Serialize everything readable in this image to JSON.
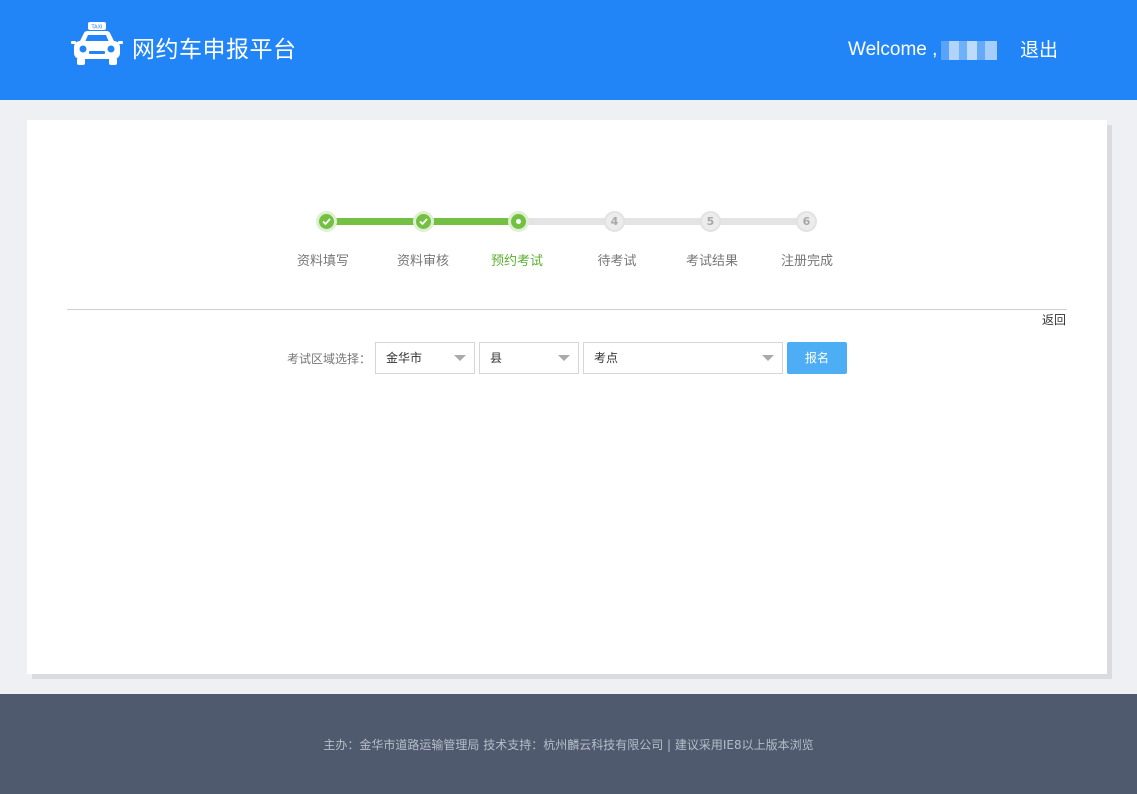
{
  "header": {
    "brand": "网约车申报平台",
    "welcome": "Welcome ,",
    "logout": "退出",
    "logo_icon": "taxi-icon"
  },
  "steps": [
    {
      "label": "资料填写",
      "number": "1",
      "state": "done"
    },
    {
      "label": "资料审核",
      "number": "2",
      "state": "done"
    },
    {
      "label": "预约考试",
      "number": "3",
      "state": "current"
    },
    {
      "label": "待考试",
      "number": "4",
      "state": "todo"
    },
    {
      "label": "考试结果",
      "number": "5",
      "state": "todo"
    },
    {
      "label": "注册完成",
      "number": "6",
      "state": "todo"
    }
  ],
  "back": "返回",
  "form": {
    "label": "考试区域选择：",
    "city": "金华市",
    "county": "县",
    "site": "考点",
    "submit": "报名"
  },
  "footer": {
    "text": "主办：金华市道路运输管理局 技术支持：杭州麟云科技有限公司 | 建议采用IE8以上版本浏览"
  },
  "colors": {
    "header": "#2185f7",
    "accent_green": "#74c043",
    "button": "#4eaef5",
    "footer": "#4f5a6e"
  }
}
